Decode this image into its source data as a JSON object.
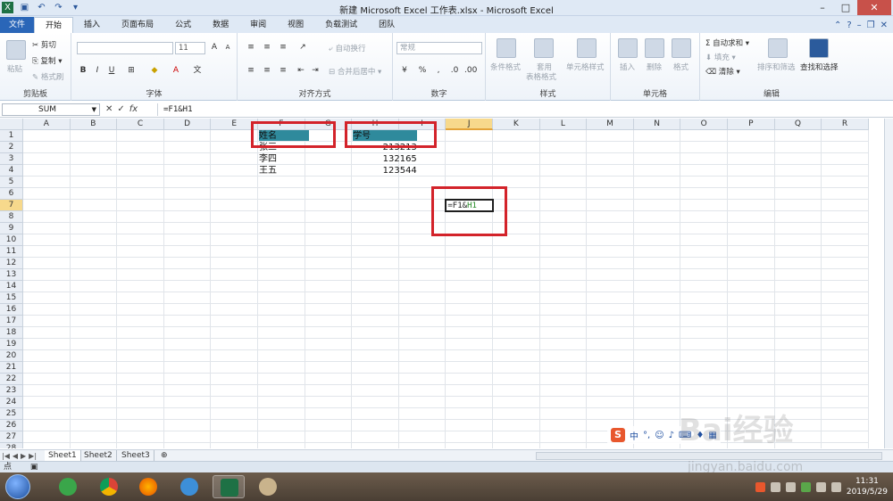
{
  "window": {
    "title": "新建 Microsoft Excel 工作表.xlsx - Microsoft Excel"
  },
  "tabs": {
    "file": "文件",
    "items": [
      "开始",
      "插入",
      "页面布局",
      "公式",
      "数据",
      "审阅",
      "视图",
      "负载测试",
      "团队"
    ],
    "active": "开始"
  },
  "ribbon": {
    "clipboard": {
      "paste": "粘贴",
      "cut": "剪切",
      "copy": "复制",
      "format_painter": "格式刷",
      "label": "剪贴板"
    },
    "font": {
      "size": "11",
      "label": "字体",
      "bold": "B",
      "italic": "I",
      "underline": "U"
    },
    "alignment": {
      "wrap": "自动换行",
      "merge": "合并后居中",
      "label": "对齐方式"
    },
    "number": {
      "format": "常规",
      "label": "数字",
      "percent": "%"
    },
    "styles": {
      "conditional": "条件格式",
      "table_line1": "套用",
      "table_line2": "表格格式",
      "cell_styles": "单元格样式",
      "label": "样式"
    },
    "cells": {
      "insert": "插入",
      "delete": "删除",
      "format": "格式",
      "label": "单元格"
    },
    "editing": {
      "autosum": "自动求和",
      "fill": "填充",
      "clear": "清除",
      "sort": "排序和筛选",
      "find": "查找和选择",
      "label": "编辑"
    }
  },
  "formula_bar": {
    "name_box": "SUM",
    "cancel": "✕",
    "enter": "✓",
    "fx": "fx",
    "formula": "=F1&H1"
  },
  "columns": [
    "A",
    "B",
    "C",
    "D",
    "E",
    "F",
    "G",
    "H",
    "I",
    "J",
    "K",
    "L",
    "M",
    "N",
    "O",
    "P",
    "Q",
    "R"
  ],
  "rows": [
    "1",
    "2",
    "3",
    "4",
    "5",
    "6",
    "7",
    "8",
    "9",
    "10",
    "11",
    "12",
    "13",
    "14",
    "15",
    "16",
    "17",
    "18",
    "19",
    "20",
    "21",
    "22",
    "23",
    "24",
    "25",
    "26",
    "27",
    "28"
  ],
  "selected": {
    "column": "J",
    "row": "7"
  },
  "cells": {
    "F1": "姓名",
    "H1": "学号",
    "F2": "张三",
    "H2": "213213",
    "F3": "李四",
    "H3": "132165",
    "F4": "王五",
    "H4": "123544",
    "J7_prefix": "=F1&",
    "J7_ref": "H1"
  },
  "sheets": {
    "items": [
      "Sheet1",
      "Sheet2",
      "Sheet3"
    ],
    "active": "Sheet1"
  },
  "status": {
    "mode": "点"
  },
  "ime": {
    "input": "中"
  },
  "watermark": {
    "logo": "Bai经验",
    "url": "jingyan.baidu.com"
  },
  "taskbar": {
    "time": "11:31",
    "date": "2019/5/29"
  },
  "colors": {
    "header_highlight": "#2f8a9c",
    "annotation": "#d3232a",
    "ribbon_file": "#2a66b8"
  }
}
